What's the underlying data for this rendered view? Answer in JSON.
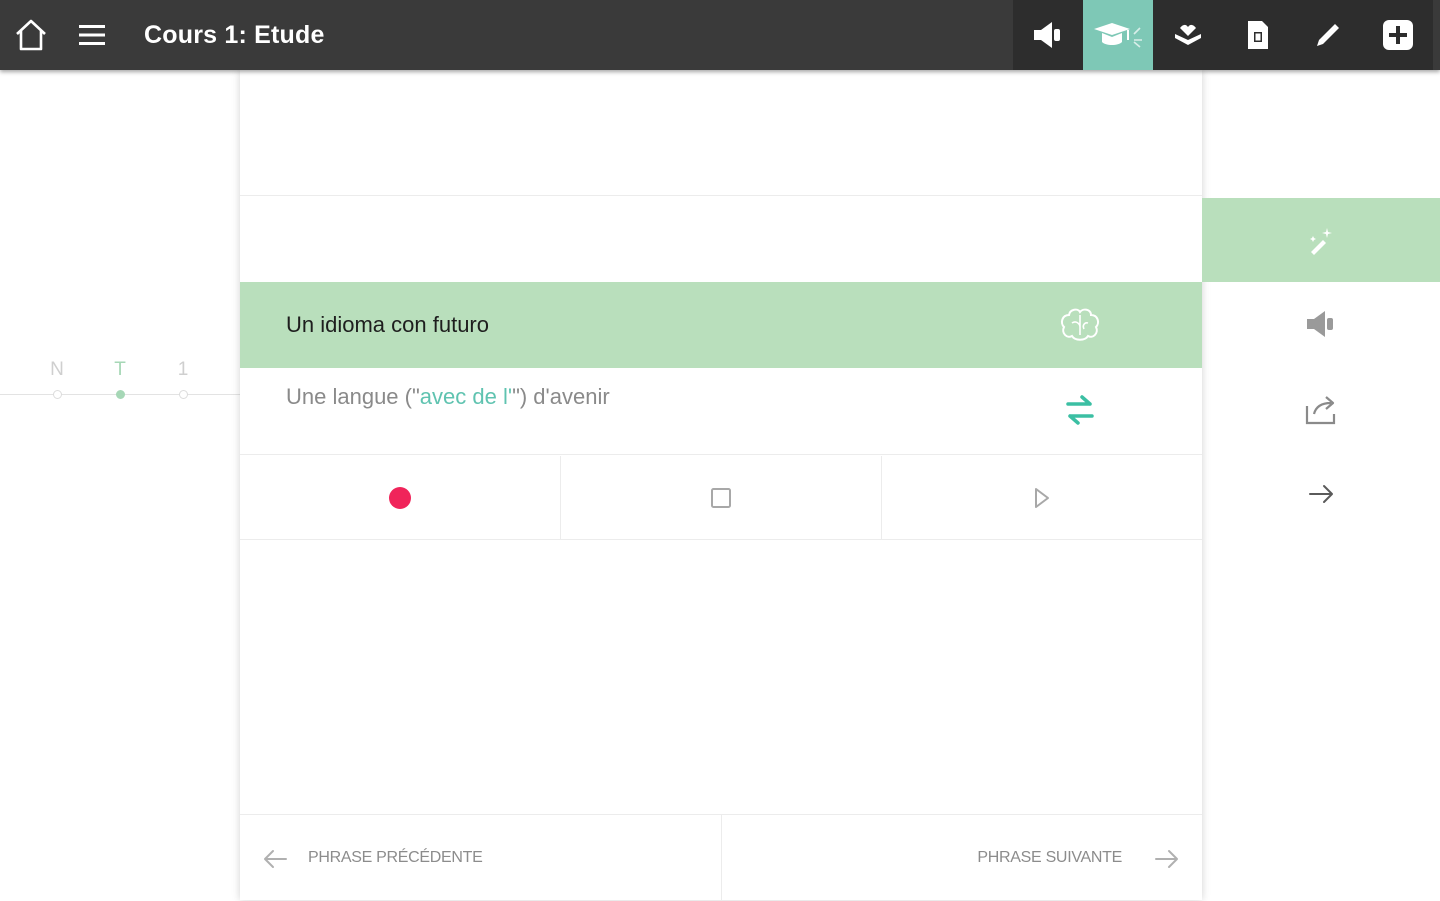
{
  "header": {
    "title": "Cours 1: Etude",
    "home_icon": "home-icon",
    "menu_icon": "hamburger-menu-icon"
  },
  "toolbar": {
    "items": [
      {
        "icon": "speaker-icon",
        "active": false
      },
      {
        "icon": "graduation-cap-icon",
        "active": true
      },
      {
        "icon": "book-hand-icon",
        "active": false
      },
      {
        "icon": "document-icon",
        "active": false
      },
      {
        "icon": "pencil-icon",
        "active": false
      },
      {
        "icon": "plus-icon",
        "active": false
      }
    ]
  },
  "progress": {
    "steps": [
      {
        "label": "N",
        "active": false
      },
      {
        "label": "T",
        "active": true
      },
      {
        "label": "1",
        "active": false
      }
    ]
  },
  "lesson": {
    "phrase": "Un idioma con futuro",
    "translation": {
      "before": "Une langue (\"",
      "highlight": "avec de l'",
      "after": "\") d'avenir"
    }
  },
  "controls": {
    "record_icon": "record-icon",
    "stop_icon": "stop-icon",
    "play_icon": "play-icon"
  },
  "footer": {
    "prev_label": "PHRASE PRÉCÉDENTE",
    "next_label": "PHRASE SUIVANTE"
  },
  "side_panel": {
    "items": [
      {
        "icon": "magic-wand-icon",
        "active": true
      },
      {
        "icon": "speaker-icon",
        "active": false
      },
      {
        "icon": "share-icon",
        "active": false
      },
      {
        "icon": "arrow-right-icon",
        "active": false
      }
    ]
  },
  "colors": {
    "topbar": "#3a3a3a",
    "accent_teal": "#7ec8b6",
    "phrase_highlight": "#b9dfbc",
    "record_red": "#f0245a",
    "translation_highlight": "#5fc3b0"
  }
}
